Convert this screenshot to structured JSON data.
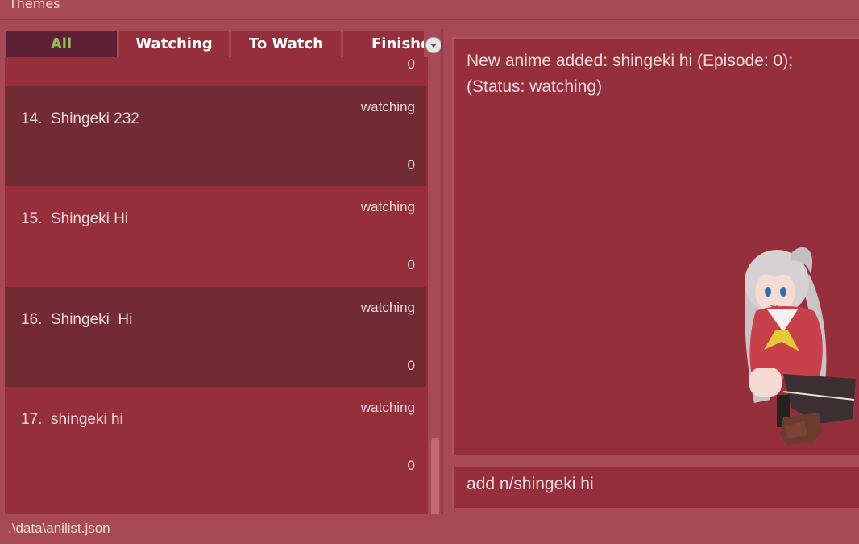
{
  "menu": {
    "themes_label": "Themes"
  },
  "tabs": [
    {
      "label": "All",
      "selected": true
    },
    {
      "label": "Watching",
      "selected": false
    },
    {
      "label": "To Watch",
      "selected": false
    },
    {
      "label": "Finished",
      "selected": false
    }
  ],
  "anime_list": [
    {
      "title": "",
      "status": "",
      "episode": "0"
    },
    {
      "title": "14.  Shingeki 232",
      "status": "watching",
      "episode": "0"
    },
    {
      "title": "15.  Shingeki Hi",
      "status": "watching",
      "episode": "0"
    },
    {
      "title": "16.  Shingeki  Hi",
      "status": "watching",
      "episode": "0"
    },
    {
      "title": "17.  shingeki hi",
      "status": "watching",
      "episode": "0"
    }
  ],
  "result_display": {
    "text": "New anime added: shingeki hi (Episode: 0);\n(Status: watching)"
  },
  "command_box": {
    "value": "add n/shingeki hi"
  },
  "status_bar": {
    "file_path": ".\\data\\anilist.json"
  },
  "colors": {
    "background": "#a84a55",
    "card": "#952f3b",
    "card_alt": "#722b35",
    "selected_tab": "#5e2034",
    "selected_tab_text": "#8fbf5a",
    "text": "#f1d9dc"
  }
}
